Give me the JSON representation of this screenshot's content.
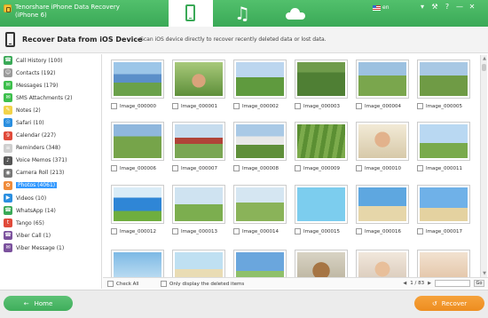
{
  "window": {
    "title_line1": "Tenorshare iPhone Data Recovery",
    "title_line2": "(iPhone 6)",
    "language": "en",
    "controls": [
      "▾",
      "⚒",
      "?",
      "—",
      "✕"
    ]
  },
  "header": {
    "title": "Recover Data from iOS Device",
    "subtitle": "- Scan iOS device directly to recover recently deleted data or lost data."
  },
  "sidebar": {
    "items": [
      {
        "label": "Call History (100)",
        "icon": "phone-icon",
        "color": "#3aa957",
        "glyph": "☎"
      },
      {
        "label": "Contacts (192)",
        "icon": "contacts-icon",
        "color": "#9a9a9a",
        "glyph": "☺"
      },
      {
        "label": "Messages (179)",
        "icon": "messages-icon",
        "color": "#3dbf4c",
        "glyph": "✉"
      },
      {
        "label": "SMS Attachments (2)",
        "icon": "attachment-icon",
        "color": "#3dbf4c",
        "glyph": "✉"
      },
      {
        "label": "Notes (2)",
        "icon": "notes-icon",
        "color": "#f2d34a",
        "glyph": "✎"
      },
      {
        "label": "Safari (10)",
        "icon": "safari-icon",
        "color": "#2b8fe0",
        "glyph": "☉"
      },
      {
        "label": "Calendar (227)",
        "icon": "calendar-icon",
        "color": "#e04a3a",
        "glyph": "9"
      },
      {
        "label": "Reminders (348)",
        "icon": "reminders-icon",
        "color": "#cfcfcf",
        "glyph": "≡"
      },
      {
        "label": "Voice Memos (371)",
        "icon": "voice-memos-icon",
        "color": "#555555",
        "glyph": "♪"
      },
      {
        "label": "Camera Roll (213)",
        "icon": "camera-icon",
        "color": "#777777",
        "glyph": "◉"
      },
      {
        "label": "Photos (4061)",
        "icon": "photos-icon",
        "color": "#f08b3a",
        "glyph": "✿"
      },
      {
        "label": "Videos (10)",
        "icon": "videos-icon",
        "color": "#2b8fe0",
        "glyph": "▶"
      },
      {
        "label": "WhatsApp (14)",
        "icon": "whatsapp-icon",
        "color": "#3aa957",
        "glyph": "☎"
      },
      {
        "label": "Tango (65)",
        "icon": "tango-icon",
        "color": "#e04a3a",
        "glyph": "t"
      },
      {
        "label": "Viber Call (1)",
        "icon": "viber-call-icon",
        "color": "#7b519d",
        "glyph": "☎"
      },
      {
        "label": "Viber Message (1)",
        "icon": "viber-message-icon",
        "color": "#7b519d",
        "glyph": "✉"
      }
    ],
    "selected_index": 10
  },
  "photos": [
    {
      "name": "Image_000000",
      "scene": "bluebonnet-field"
    },
    {
      "name": "Image_000001",
      "scene": "family-portrait"
    },
    {
      "name": "Image_000002",
      "scene": "couple-walking"
    },
    {
      "name": "Image_000003",
      "scene": "horse-meadow"
    },
    {
      "name": "Image_000004",
      "scene": "cows-pasture"
    },
    {
      "name": "Image_000005",
      "scene": "cow-standing"
    },
    {
      "name": "Image_000006",
      "scene": "farmhouse-horses"
    },
    {
      "name": "Image_000007",
      "scene": "red-barn-horses"
    },
    {
      "name": "Image_000008",
      "scene": "white-barn"
    },
    {
      "name": "Image_000009",
      "scene": "garden-rows"
    },
    {
      "name": "Image_000010",
      "scene": "child-lying"
    },
    {
      "name": "Image_000011",
      "scene": "friends-jumping"
    },
    {
      "name": "Image_000012",
      "scene": "girl-on-slide"
    },
    {
      "name": "Image_000013",
      "scene": "family-walking"
    },
    {
      "name": "Image_000014",
      "scene": "family-outdoors"
    },
    {
      "name": "Image_000015",
      "scene": "pool-fun"
    },
    {
      "name": "Image_000016",
      "scene": "beach-piggyback"
    },
    {
      "name": "Image_000017",
      "scene": "kids-jumping"
    },
    {
      "name": "",
      "scene": "kid-portrait"
    },
    {
      "name": "",
      "scene": "beach-couple"
    },
    {
      "name": "",
      "scene": "sky-field"
    },
    {
      "name": "",
      "scene": "dog"
    },
    {
      "name": "",
      "scene": "girl-portrait"
    },
    {
      "name": "",
      "scene": "girls-laughing"
    }
  ],
  "footer_filter": {
    "check_all": "Check All",
    "only_deleted": "Only display the deleted items",
    "pager_left": "◀",
    "page": "1 / 83",
    "pager_right": "▶",
    "go": "Go"
  },
  "footer": {
    "home_label": "Home",
    "home_icon": "←",
    "recover_label": "Recover",
    "recover_icon": "↺"
  }
}
